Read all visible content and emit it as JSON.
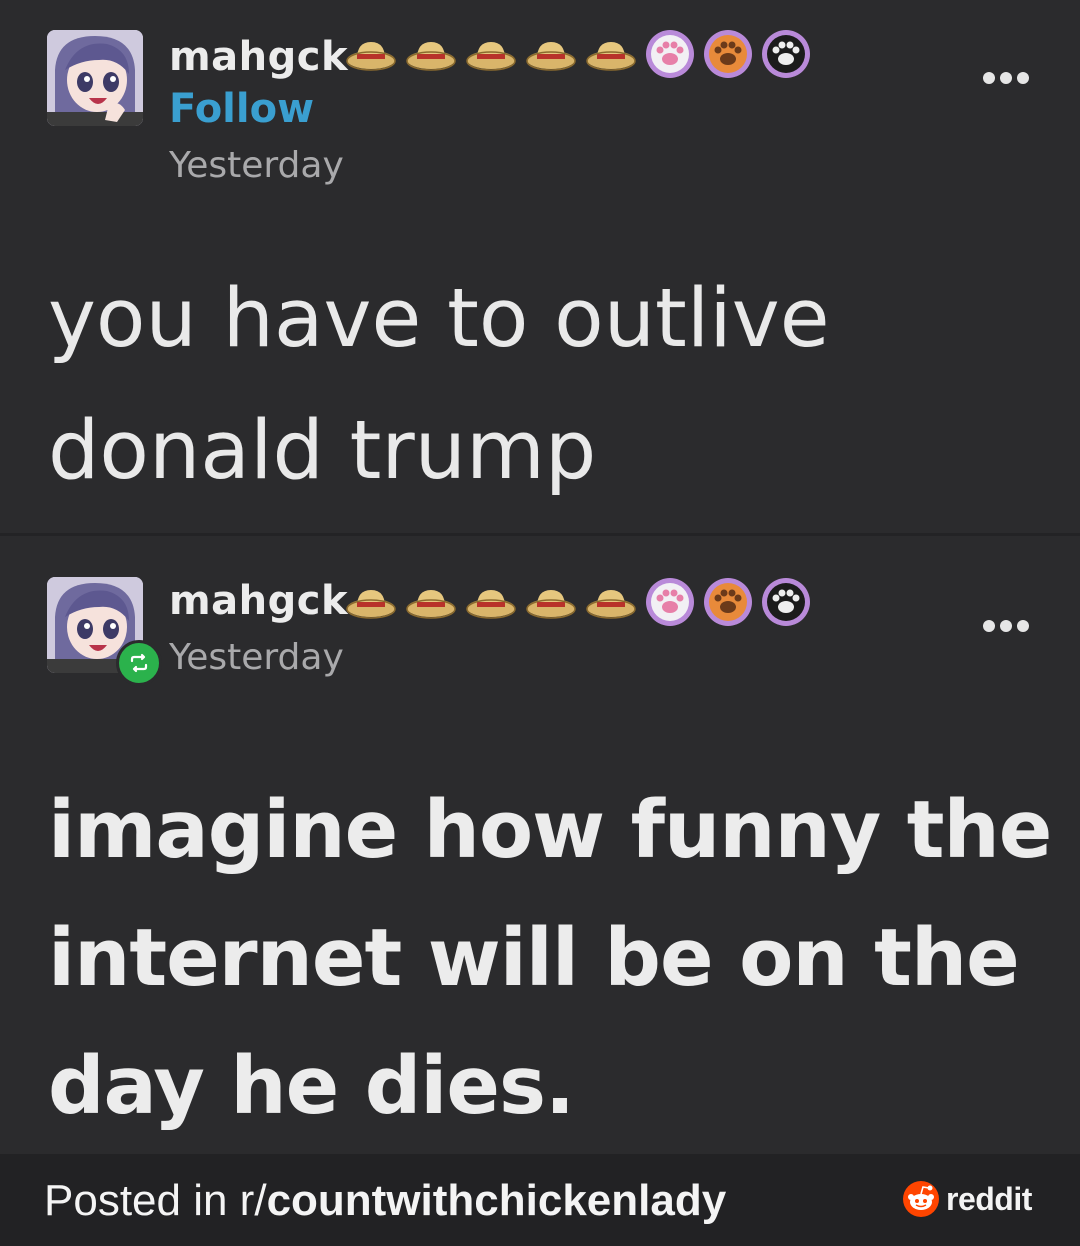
{
  "post_original": {
    "username": "mahgck",
    "follow_label": "Follow",
    "timestamp": "Yesterday",
    "body": "you have to outlive donald trump",
    "badges": [
      "straw-hat-icon",
      "straw-hat-icon",
      "straw-hat-icon",
      "straw-hat-icon",
      "straw-hat-icon",
      "pink-paw-icon",
      "orange-paw-icon",
      "black-paw-icon"
    ]
  },
  "post_reblog": {
    "username": "mahgck",
    "timestamp": "Yesterday",
    "body": "imagine how funny the internet will be on the day he dies."
  },
  "footer": {
    "prefix": "Posted in r/",
    "subreddit": "countwithchickenlady",
    "brand": "reddit"
  },
  "colors": {
    "background": "#2b2b2d",
    "follow_blue": "#3a9fd0",
    "reblog_green": "#2bb24c",
    "reddit_orange": "#ff4500"
  }
}
